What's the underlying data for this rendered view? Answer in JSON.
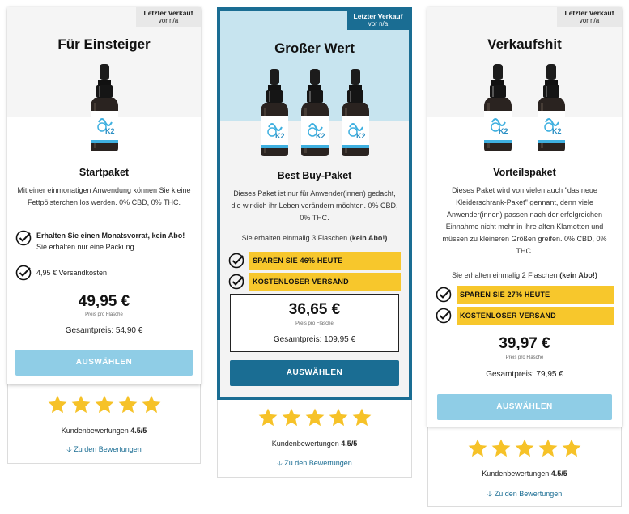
{
  "colors": {
    "accent_blue": "#1a6d93",
    "button_light": "#8fcde6",
    "highlight_yellow": "#f7c72c",
    "star_yellow": "#f6c228",
    "featured_bg": "#c7e4ef"
  },
  "badge": {
    "line1": "Letzter Verkauf",
    "line2": "vor n/a"
  },
  "cards": [
    {
      "title": "Für Einsteiger",
      "package": "Startpaket",
      "description": "Mit einer einmonatigen Anwendung können Sie kleine Fettpölsterchen los werden. 0% CBD, 0% THC.",
      "features": [
        {
          "bold": "Erhalten Sie einen Monatsvorrat, kein Abo!",
          "text": " Sie erhalten nur eine Packung."
        },
        {
          "bold": "",
          "text": "4,95 € Versandkosten"
        }
      ],
      "price": "49,95 €",
      "per_unit": "Preis pro Flasche",
      "total": "Gesamtpreis: 54,90 €",
      "button": "AUSWÄHLEN",
      "rating_text": "Kundenbewertungen",
      "rating_value": "4.5/5",
      "rating_stars": 5,
      "reviews_link": "Zu den Bewertungen"
    },
    {
      "title": "Großer Wert",
      "package": "Best Buy-Paket",
      "description": "Dieses Paket ist nur für Anwender(innen) gedacht, die wirklich ihr Leben verändern möchten. 0% CBD, 0% THC.",
      "bottles_note": "Sie erhalten einmalig 3 Flaschen",
      "bottles_note_bold": "(kein Abo!)",
      "highlights": [
        "SPAREN SIE 46% HEUTE",
        "KOSTENLOSER VERSAND"
      ],
      "price": "36,65 €",
      "per_unit": "Preis pro Flasche",
      "total": "Gesamtpreis: 109,95 €",
      "button": "AUSWÄHLEN",
      "rating_text": "Kundenbewertungen",
      "rating_value": "4.5/5",
      "rating_stars": 5,
      "reviews_link": "Zu den Bewertungen"
    },
    {
      "title": "Verkaufshit",
      "package": "Vorteilspaket",
      "description": "Dieses Paket wird von vielen auch \"das neue Kleiderschrank-Paket\" gennant, denn viele Anwender(innen) passen nach der erfolgreichen Einnahme nicht mehr in ihre alten Klamotten und müssen zu kleineren Größen greifen. 0% CBD, 0% THC.",
      "bottles_note": "Sie erhalten einmalig 2 Flaschen",
      "bottles_note_bold": "(kein Abo!)",
      "highlights": [
        "SPAREN SIE 27% HEUTE",
        "KOSTENLOSER VERSAND"
      ],
      "price": "39,97 €",
      "per_unit": "Preis pro Flasche",
      "total": "Gesamtpreis: 79,95 €",
      "button": "AUSWÄHLEN",
      "rating_text": "Kundenbewertungen",
      "rating_value": "4.5/5",
      "rating_stars": 5,
      "reviews_link": "Zu den Bewertungen"
    }
  ]
}
